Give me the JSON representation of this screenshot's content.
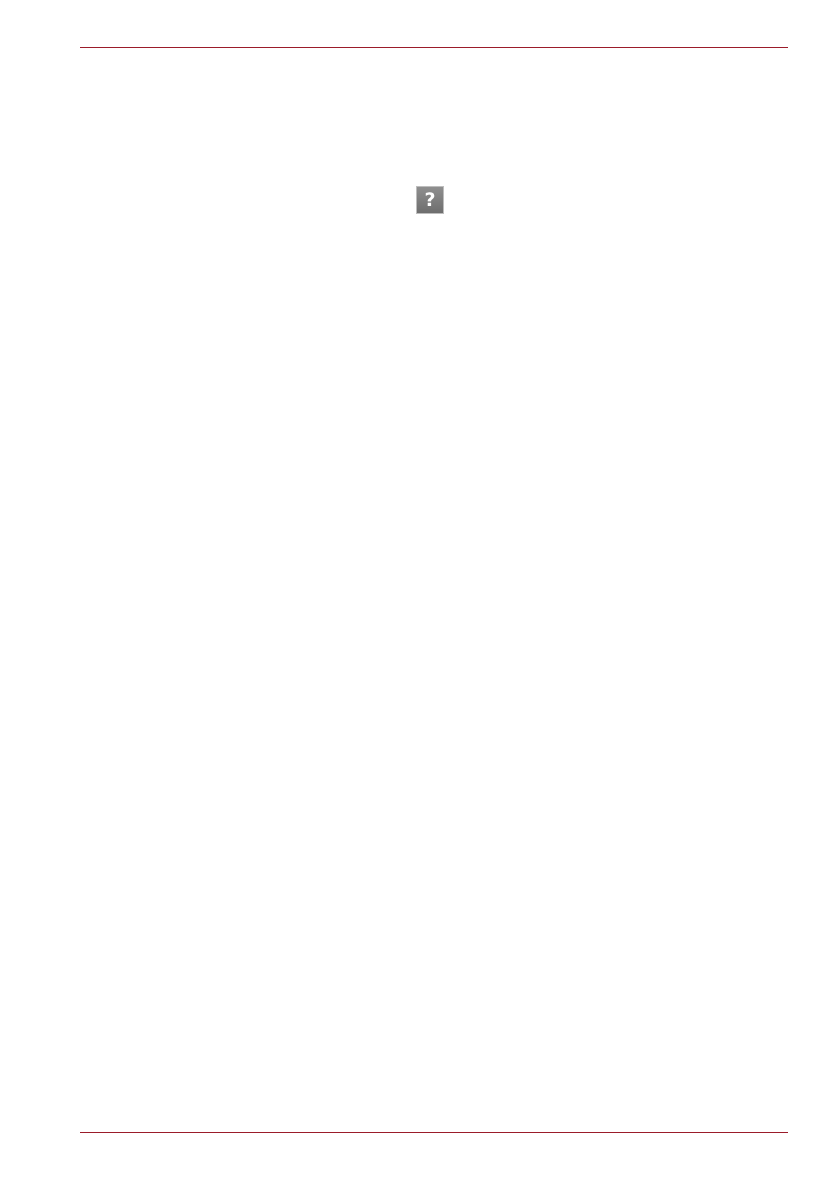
{
  "page": {
    "accent_color": "#9b1c2a"
  },
  "help_icon": {
    "icon": "help-icon",
    "glyph": "?"
  }
}
